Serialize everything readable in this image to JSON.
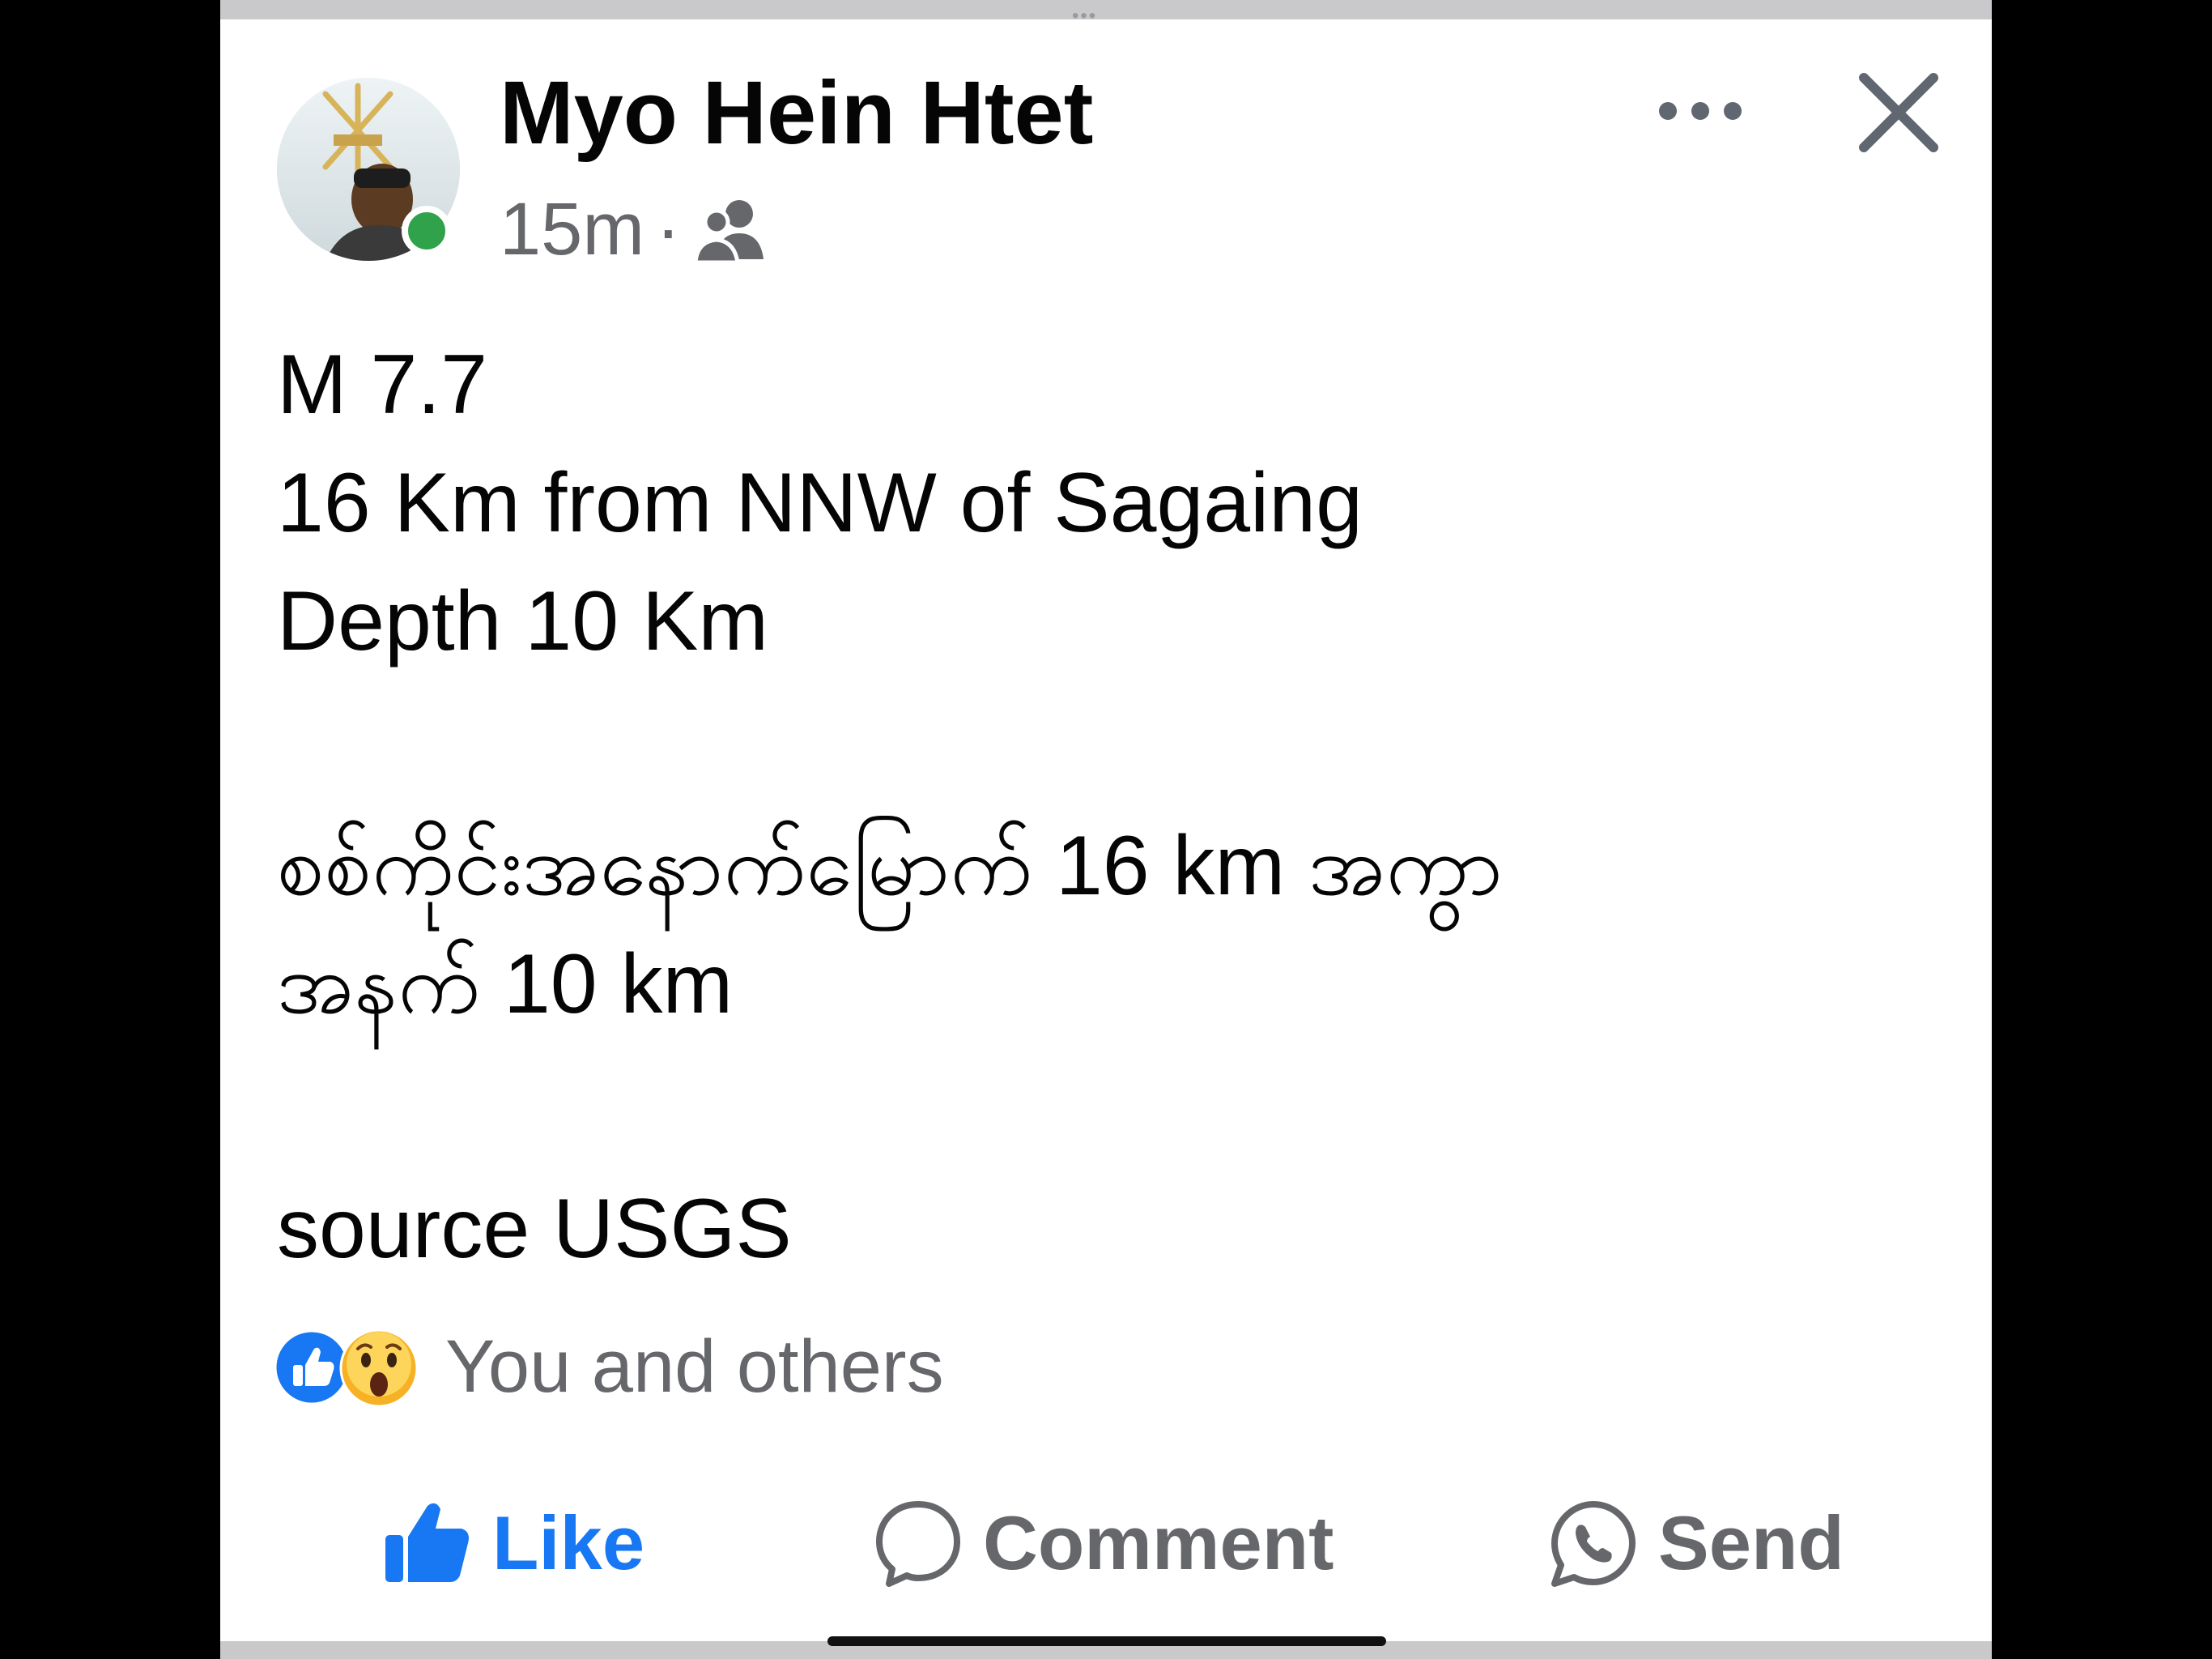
{
  "post": {
    "author": "Myo Hein Htet",
    "time": "15m",
    "separator": "·",
    "audience_icon": "friends-icon",
    "body_lines": [
      "M 7.7",
      "16 Km from NNW of Sagaing",
      "Depth 10 Km",
      "စစ်ကိုင်းအနောက်မြောက် 16 km အကွာ",
      "အနက် 10 km",
      "source USGS"
    ]
  },
  "reactions": {
    "icons": [
      "like-reaction-icon",
      "wow-reaction-icon"
    ],
    "summary": "You and others"
  },
  "actions": {
    "like": "Like",
    "comment": "Comment",
    "send": "Send"
  },
  "colors": {
    "accent": "#1877f2",
    "online": "#31a24c",
    "secondary_text": "#65676b",
    "primary_text": "#050505"
  }
}
